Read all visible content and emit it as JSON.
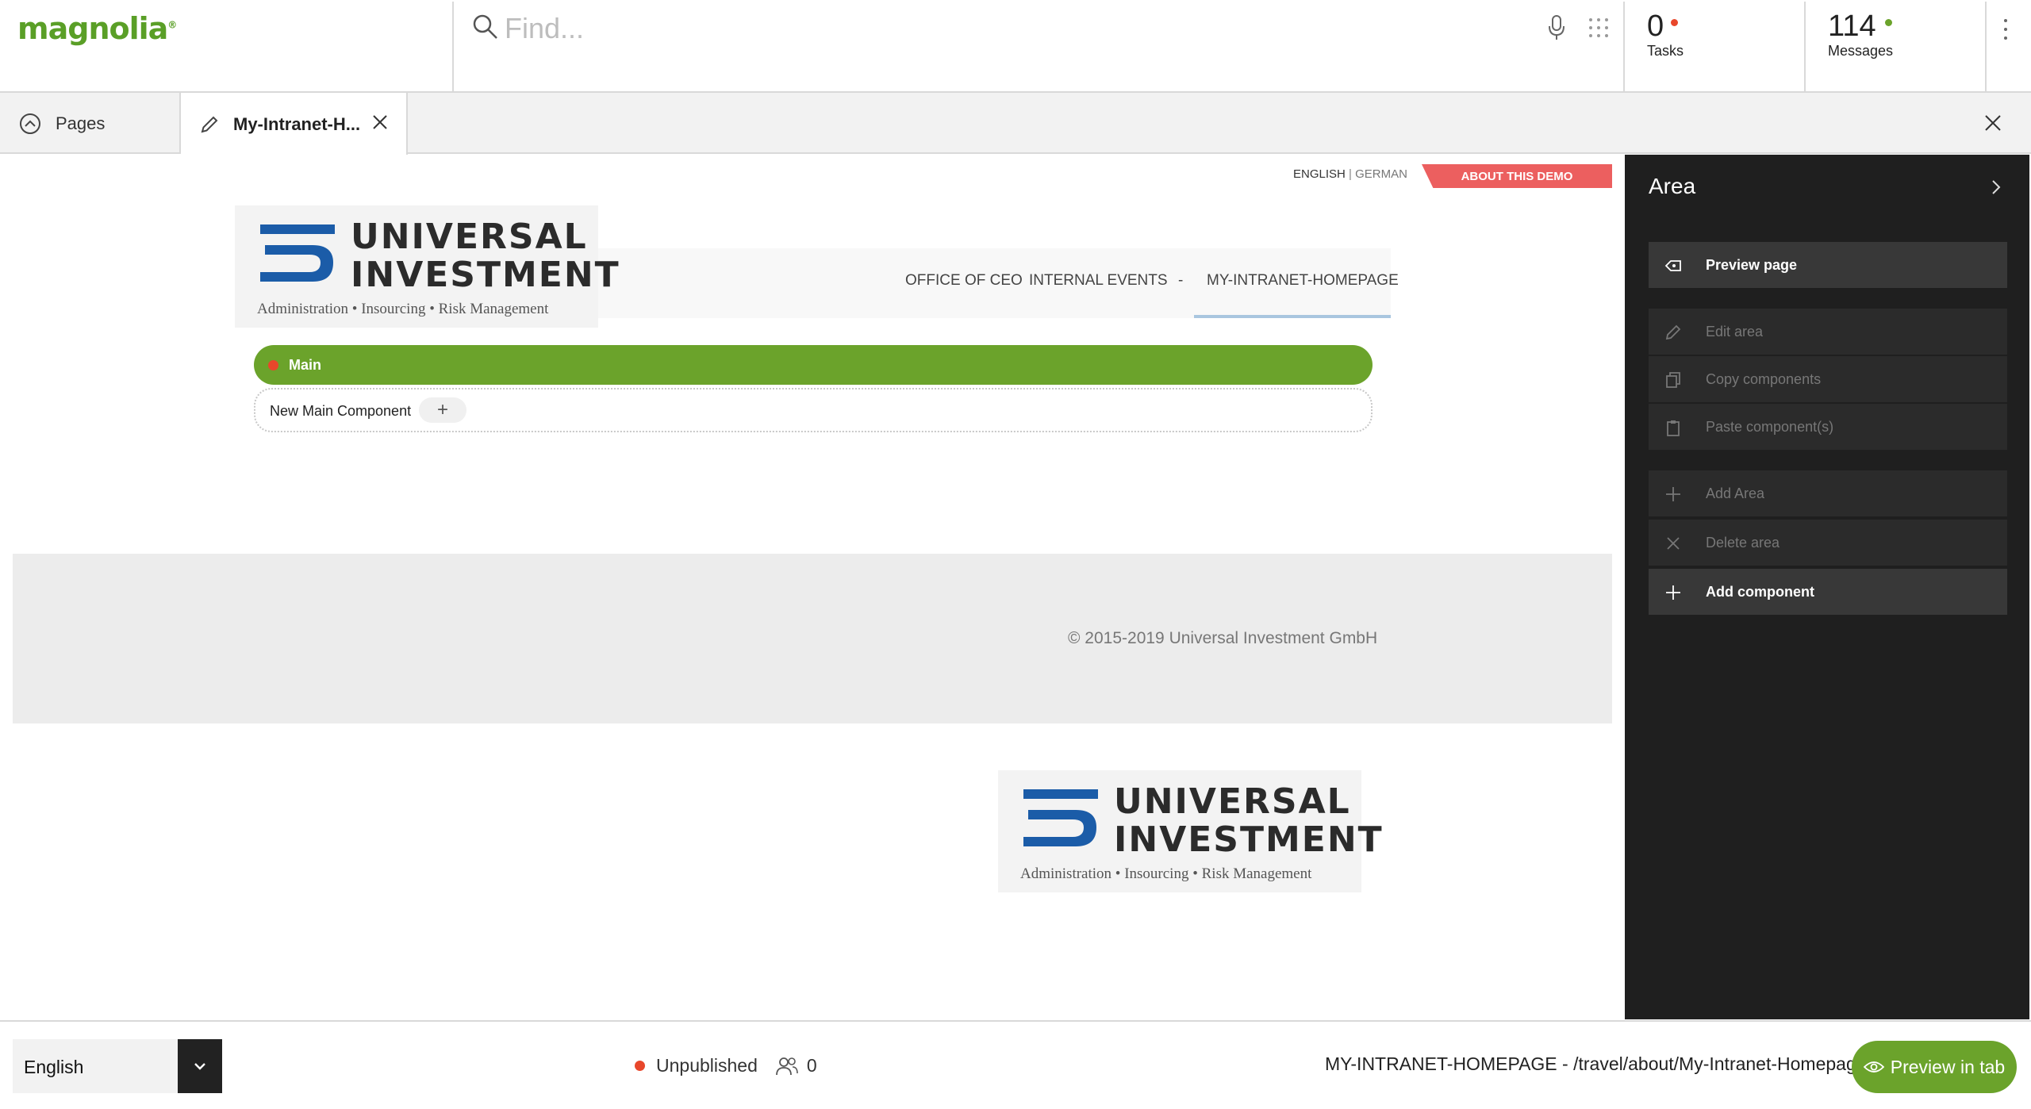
{
  "header": {
    "logo": "magnolia",
    "search_placeholder": "Find...",
    "tasks": {
      "count": "0",
      "label": "Tasks",
      "dot_color": "#e8472b"
    },
    "messages": {
      "count": "114",
      "label": "Messages",
      "dot_color": "#6ba32b"
    }
  },
  "tabs": {
    "pages_label": "Pages",
    "page_label": "My-Intranet-H..."
  },
  "site": {
    "lang_en": "ENGLISH",
    "lang_sep": "|",
    "lang_de": "GERMAN",
    "about_demo": "ABOUT THIS DEMO",
    "logo_line1": "UNIVERSAL",
    "logo_line2": "INVESTMENT",
    "logo_tagline": "Administration • Insourcing • Risk Management",
    "nav": [
      "OFFICE OF CEO",
      "INTERNAL EVENTS",
      "-",
      "MY-INTRANET-HOMEPAGE"
    ],
    "main_area_label": "Main",
    "new_component_label": "New Main Component",
    "copyright": "© 2015-2019 Universal Investment GmbH"
  },
  "panel": {
    "title": "Area",
    "actions": [
      {
        "label": "Preview page",
        "icon": "eye-tag-icon",
        "enabled": true
      },
      {
        "label": "Edit area",
        "icon": "pencil-icon",
        "enabled": false
      },
      {
        "label": "Copy components",
        "icon": "copy-icon",
        "enabled": false
      },
      {
        "label": "Paste component(s)",
        "icon": "clipboard-icon",
        "enabled": false
      },
      {
        "label": "Add Area",
        "icon": "plus-icon",
        "enabled": false
      },
      {
        "label": "Delete area",
        "icon": "x-icon",
        "enabled": false
      },
      {
        "label": "Add component",
        "icon": "plus-icon",
        "enabled": true
      }
    ]
  },
  "footer": {
    "language": "English",
    "status": "Unpublished",
    "users_count": "0",
    "path": "MY-INTRANET-HOMEPAGE - /travel/about/My-Intranet-Homepage",
    "preview_tab": "Preview in tab"
  },
  "colors": {
    "brand_green": "#6ba32b",
    "status_red": "#e8472b",
    "demo_red": "#ec5f5f",
    "panel_bg": "#1f1f1f"
  }
}
